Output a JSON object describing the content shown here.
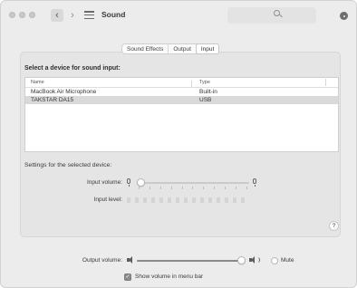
{
  "window": {
    "title": "Sound",
    "search_placeholder": ""
  },
  "toolbar": {
    "back_glyph": "‹",
    "forward_glyph": "›",
    "icons": [
      "grid-icon",
      "search-icon",
      "gear-icon"
    ]
  },
  "tabs": [
    {
      "label": "Sound Effects",
      "active": false
    },
    {
      "label": "Output",
      "active": false
    },
    {
      "label": "Input",
      "active": true
    }
  ],
  "input": {
    "heading": "Select a device for sound input:",
    "columns": [
      "Name",
      "Type"
    ],
    "devices": [
      {
        "name": "MacBook Air Microphone",
        "type": "Built-in",
        "selected": false
      },
      {
        "name": "TAKSTAR DA15",
        "type": "USB",
        "selected": true
      }
    ],
    "settings_label": "Settings for the selected device:",
    "input_volume_label": "Input volume:",
    "input_volume_level": 0.0,
    "input_level_label": "Input level:",
    "input_level_segments": 15,
    "input_level_active": 0
  },
  "help_label": "?",
  "output": {
    "volume_label": "Output volume:",
    "volume_level": 1.0,
    "mute_label": "Mute",
    "mute_checked": false,
    "menu_bar_label": "Show volume in menu bar",
    "menu_bar_checked": true
  },
  "colors": {
    "window_bg": "#ececec",
    "panel_bg": "#e5e5e5",
    "selected_row": "#d9d9d9",
    "accent_checkbox": "#8c8c8c"
  }
}
